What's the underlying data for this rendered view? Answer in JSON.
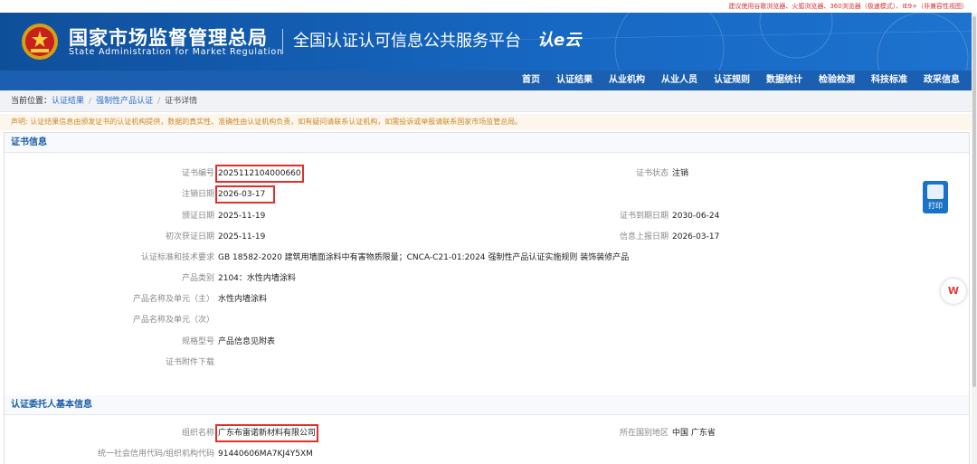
{
  "top_notice": "建议使用谷歌浏览器、火狐浏览器、360浏览器（极速模式）、IE9+（非兼容性视图）",
  "header": {
    "org_name_cn": "国家市场监督管理总局",
    "org_name_en": "State Administration  for  Market Regulation",
    "platform_title": "全国认证认可信息公共服务平台",
    "platform_logo": "认e云"
  },
  "nav": {
    "items": [
      "首页",
      "认证结果",
      "从业机构",
      "从业人员",
      "认证规则",
      "数据统计",
      "检验检测",
      "科技标准",
      "政采信息"
    ]
  },
  "breadcrumb": {
    "prefix": "当前位置：",
    "items": [
      "认证结果",
      "强制性产品认证",
      "证书详情"
    ],
    "sep": "/"
  },
  "disclaimer": "声明: 认证结果信息由颁发证书的认证机构提供，数据的真实性、准确性由认证机构负责，如有疑问请联系认证机构，如需投诉或举报请联系国家市场监管总局。",
  "cert_section": {
    "title": "证书信息",
    "fields": {
      "cert_no_label": "证书编号",
      "cert_no": "2025112104000660",
      "status_label": "证书状态",
      "status": "注销",
      "cancel_date_label": "注销日期",
      "cancel_date": "2026-03-17",
      "issue_date_label": "颁证日期",
      "issue_date": "2025-11-19",
      "expire_date_label": "证书到期日期",
      "expire_date": "2030-06-24",
      "first_date_label": "初次获证日期",
      "first_date": "2025-11-19",
      "report_date_label": "信息上报日期",
      "report_date": "2026-03-17",
      "standard_label": "认证标准和技术要求",
      "standard": "GB 18582-2020 建筑用墙面涂料中有害物质限量；CNCA-C21-01:2024 强制性产品认证实施规则 装饰装修产品",
      "category_label": "产品类别",
      "category": "2104：水性内墙涂料",
      "product_main_label": "产品名称及单元（主）",
      "product_main": "水性内墙涂料",
      "product_sub_label": "产品名称及单元（次）",
      "product_sub": "",
      "model_label": "规格型号",
      "model": "产品信息见附表",
      "attachment_label": "证书附件下载",
      "attachment": ""
    }
  },
  "client_section": {
    "title": "认证委托人基本信息",
    "fields": {
      "org_label": "组织名称",
      "org": "广东布雷诺新材料有限公司",
      "region_label": "所在国别地区",
      "region": "中国 广东省",
      "credit_label": "统一社会信用代码/组织机构代码",
      "credit": "91440606MA7KJ4Y5XM"
    }
  },
  "print_label": "打印",
  "wps_label": "W"
}
